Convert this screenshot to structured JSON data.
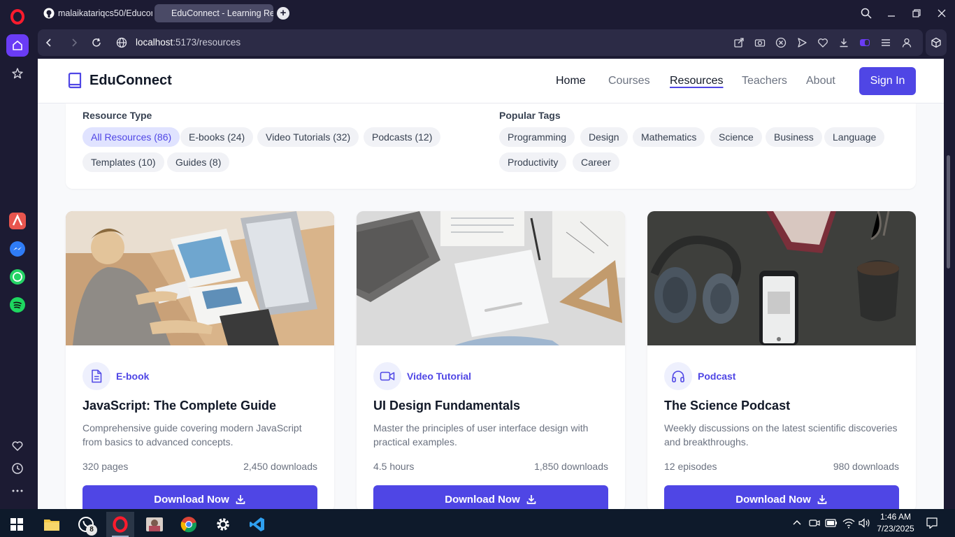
{
  "browser": {
    "tabs": [
      {
        "label": "malaikatariqcs50/Educonn"
      },
      {
        "label": "EduConnect - Learning Re"
      }
    ],
    "url_host": "localhost",
    "url_rest": ":5173/resources"
  },
  "site": {
    "brand": "EduConnect",
    "nav": {
      "home": "Home",
      "courses": "Courses",
      "resources": "Resources",
      "teachers": "Teachers",
      "about": "About"
    },
    "sign_in": "Sign In",
    "accent_color": "#4f46e5"
  },
  "filters": {
    "resource_type_label": "Resource Type",
    "resource_types": [
      "All Resources (86)",
      "E-books (24)",
      "Video Tutorials (32)",
      "Podcasts (12)",
      "Templates (10)",
      "Guides (8)"
    ],
    "selected_type": "All Resources (86)",
    "popular_tags_label": "Popular Tags",
    "tags": [
      "Programming",
      "Design",
      "Mathematics",
      "Science",
      "Business",
      "Language",
      "Productivity",
      "Career"
    ]
  },
  "resources": [
    {
      "type": "E-book",
      "icon": "document-icon",
      "title": "JavaScript: The Complete Guide",
      "description": "Comprehensive guide covering modern JavaScript from basics to advanced concepts.",
      "meta_left": "320 pages",
      "meta_right": "2,450 downloads",
      "button": "Download Now"
    },
    {
      "type": "Video Tutorial",
      "icon": "video-camera-icon",
      "title": "UI Design Fundamentals",
      "description": "Master the principles of user interface design with practical examples.",
      "meta_left": "4.5 hours",
      "meta_right": "1,850 downloads",
      "button": "Download Now"
    },
    {
      "type": "Podcast",
      "icon": "headphones-icon",
      "title": "The Science Podcast",
      "description": "Weekly discussions on the latest scientific discoveries and breakthroughs.",
      "meta_left": "12 episodes",
      "meta_right": "980 downloads",
      "button": "Download Now"
    }
  ],
  "taskbar": {
    "whatsapp_badge": "8",
    "time": "1:46 AM",
    "date": "7/23/2025"
  }
}
